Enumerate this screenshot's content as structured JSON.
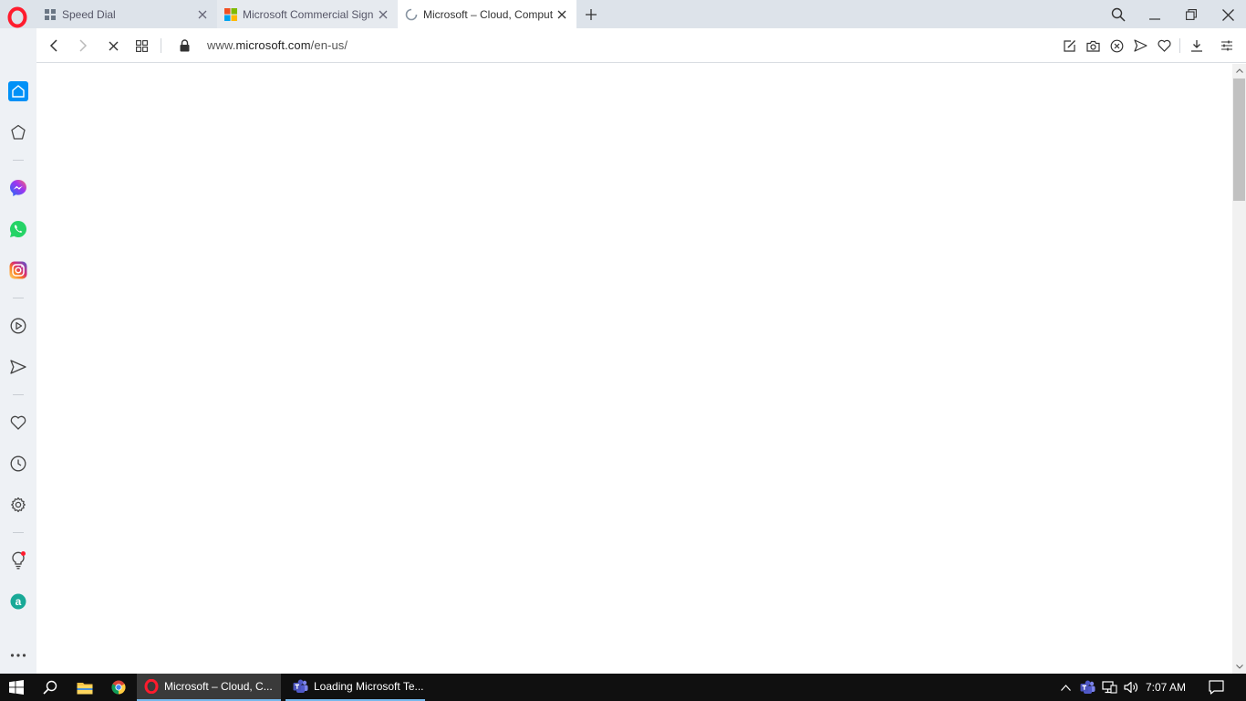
{
  "tabs": [
    {
      "title": "Speed Dial",
      "icon": "speed-dial-icon",
      "active": false
    },
    {
      "title": "Microsoft Commercial Sign",
      "icon": "microsoft-logo-icon",
      "active": false
    },
    {
      "title": "Microsoft – Cloud, Comput",
      "icon": "loading-spinner-icon",
      "active": true
    }
  ],
  "address": {
    "url_prefix": "www.",
    "url_domain": "microsoft.com",
    "url_path": "/en-us/"
  },
  "sidebar": {
    "items": [
      "home-icon",
      "bookmarks-icon",
      "messenger-icon",
      "whatsapp-icon",
      "instagram-icon",
      "player-icon",
      "flow-icon",
      "favorites-icon",
      "history-icon",
      "settings-icon",
      "tips-icon",
      "amazon-assistant-icon",
      "more-icon"
    ]
  },
  "taskbar": {
    "apps": [
      {
        "label": "Microsoft – Cloud, C...",
        "icon": "opera-icon"
      },
      {
        "label": "Loading Microsoft Te...",
        "icon": "teams-icon"
      }
    ],
    "clock": "7:07 AM"
  },
  "colors": {
    "opera_red": "#ff1b2d",
    "tab_bar": "#dde3ea",
    "sidebar": "#eef1f5",
    "home_accent": "#0091f7",
    "taskbar": "#101010"
  }
}
